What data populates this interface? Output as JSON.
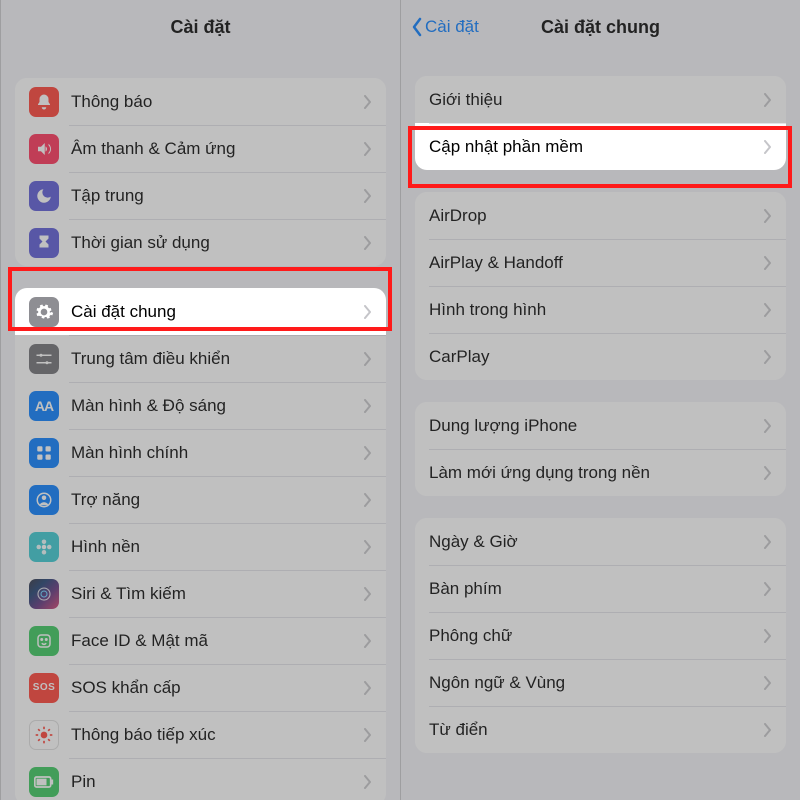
{
  "left": {
    "title": "Cài đặt",
    "group1": [
      {
        "name": "notifications",
        "label": "Thông báo",
        "iconClass": "bg-red",
        "icon": "bell"
      },
      {
        "name": "sounds",
        "label": "Âm thanh & Cảm ứng",
        "iconClass": "bg-pink",
        "icon": "speaker"
      },
      {
        "name": "focus",
        "label": "Tập trung",
        "iconClass": "bg-indigo",
        "icon": "moon"
      },
      {
        "name": "screentime",
        "label": "Thời gian sử dụng",
        "iconClass": "bg-indigo",
        "icon": "hourglass"
      }
    ],
    "group2": [
      {
        "name": "general",
        "label": "Cài đặt chung",
        "iconClass": "bg-gray",
        "icon": "gear",
        "highlight": true
      },
      {
        "name": "control-center",
        "label": "Trung tâm điều khiển",
        "iconClass": "bg-darkg",
        "icon": "sliders"
      },
      {
        "name": "display",
        "label": "Màn hình & Độ sáng",
        "iconClass": "bg-blue",
        "icon": "aa"
      },
      {
        "name": "home-screen",
        "label": "Màn hình chính",
        "iconClass": "bg-blue",
        "icon": "grid"
      },
      {
        "name": "accessibility",
        "label": "Trợ năng",
        "iconClass": "bg-blue",
        "icon": "person"
      },
      {
        "name": "wallpaper",
        "label": "Hình nền",
        "iconClass": "bg-teal",
        "icon": "flower"
      },
      {
        "name": "siri",
        "label": "Siri & Tìm kiếm",
        "iconClass": "bg-siri",
        "icon": "siri"
      },
      {
        "name": "faceid",
        "label": "Face ID & Mật mã",
        "iconClass": "bg-green",
        "icon": "face"
      },
      {
        "name": "sos",
        "label": "SOS khẩn cấp",
        "iconClass": "bg-sos",
        "icon": "sos"
      },
      {
        "name": "exposure",
        "label": "Thông báo tiếp xúc",
        "iconClass": "bg-white",
        "icon": "exposure"
      },
      {
        "name": "battery",
        "label": "Pin",
        "iconClass": "bg-green",
        "icon": "battery"
      }
    ]
  },
  "right": {
    "back": "Cài đặt",
    "title": "Cài đặt chung",
    "group1": [
      {
        "name": "about",
        "label": "Giới thiệu"
      },
      {
        "name": "software-update",
        "label": "Cập nhật phần mềm",
        "highlight": true
      }
    ],
    "group2": [
      {
        "name": "airdrop",
        "label": "AirDrop"
      },
      {
        "name": "airplay",
        "label": "AirPlay & Handoff"
      },
      {
        "name": "pip",
        "label": "Hình trong hình"
      },
      {
        "name": "carplay",
        "label": "CarPlay"
      }
    ],
    "group3": [
      {
        "name": "storage",
        "label": "Dung lượng iPhone"
      },
      {
        "name": "background-refresh",
        "label": "Làm mới ứng dụng trong nền"
      }
    ],
    "group4": [
      {
        "name": "date-time",
        "label": "Ngày & Giờ"
      },
      {
        "name": "keyboard",
        "label": "Bàn phím"
      },
      {
        "name": "fonts",
        "label": "Phông chữ"
      },
      {
        "name": "language-region",
        "label": "Ngôn ngữ & Vùng"
      },
      {
        "name": "dictionary",
        "label": "Từ điển"
      }
    ]
  }
}
